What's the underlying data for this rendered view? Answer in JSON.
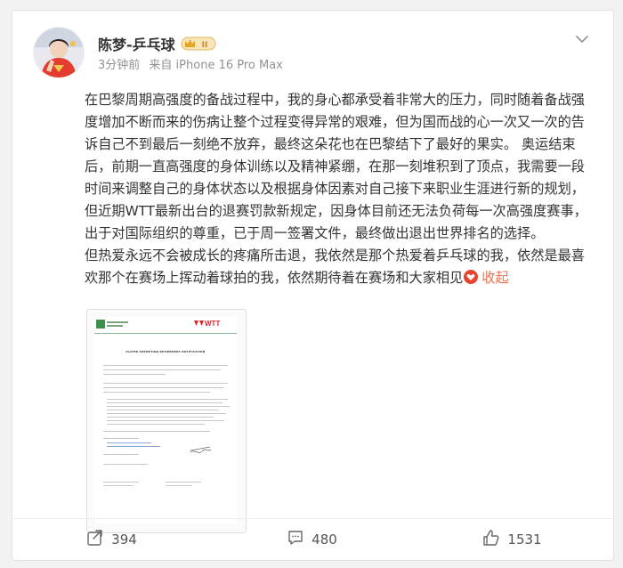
{
  "post": {
    "author": "陈梦-乒乓球",
    "badge": "II",
    "time": "3分钟前",
    "source": "来自 iPhone 16 Pro Max",
    "paragraph1": "在巴黎周期高强度的备战过程中，我的身心都承受着非常大的压力，同时随着备战强度增加不断而来的伤病让整个过程变得异常的艰难，但为国而战的心一次又一次的告诉自己不到最后一刻绝不放弃，最终这朵花也在巴黎结下了最好的果实。  奥运结束后，前期一直高强度的身体训练以及精神紧绷，在那一刻堆积到了顶点，我需要一段时间来调整自己的身体状态以及根据身体因素对自己接下来职业生涯进行新的规划，但近期WTT最新出台的退赛罚款新规定，因身体目前还无法负荷每一次高强度赛事，出于对国际组织的尊重，已于周一签署文件，最终做出退出世界排名的选择。",
    "paragraph2": "但热爱永远不会被成长的疼痛所击退，我依然是那个热爱着乒乓球的我，依然是最喜欢那个在赛场上挥动着球拍的我，依然期待着在赛场和大家相见",
    "collapse_label": "收起",
    "document": {
      "logo_text": "WTT",
      "title": "PLAYER EXEMPTION RETIREMENT NOTIFICATION"
    }
  },
  "actions": {
    "repost": "394",
    "comment": "480",
    "like": "1531"
  },
  "colors": {
    "accent": "#eb7350",
    "wtt_red": "#d8262f",
    "text": "#333333",
    "meta": "#939393"
  }
}
